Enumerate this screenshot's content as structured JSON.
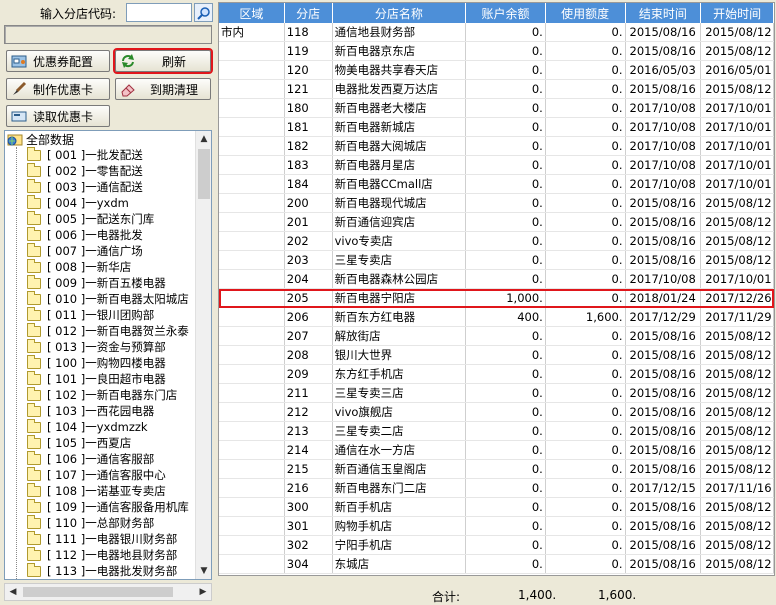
{
  "search": {
    "label": "输入分店代码:",
    "value": ""
  },
  "buttons": {
    "coupon_config": "优惠券配置",
    "refresh": "刷新",
    "make_card": "制作优惠卡",
    "expire_clean": "到期清理",
    "read_card": "读取优惠卡"
  },
  "tree": {
    "root": "全部数据",
    "items": [
      "[ 001 ]一批发配送",
      "[ 002 ]一零售配送",
      "[ 003 ]一通信配送",
      "[ 004 ]一yxdm",
      "[ 005 ]一配送东门库",
      "[ 006 ]一电器批发",
      "[ 007 ]一通信广场",
      "[ 008 ]一新华店",
      "[ 009 ]一新百五楼电器",
      "[ 010 ]一新百电器太阳城店",
      "[ 011 ]一银川团购部",
      "[ 012 ]一新百电器贺兰永泰",
      "[ 013 ]一资金与预算部",
      "[ 100 ]一购物四楼电器",
      "[ 101 ]一良田超市电器",
      "[ 102 ]一新百电器东门店",
      "[ 103 ]一西花园电器",
      "[ 104 ]一yxdmzzk",
      "[ 105 ]一西夏店",
      "[ 106 ]一通信客服部",
      "[ 107 ]一通信客服中心",
      "[ 108 ]一诺基亚专卖店",
      "[ 109 ]一通信客服备用机库",
      "[ 110 ]一总部财务部",
      "[ 111 ]一电器银川财务部",
      "[ 112 ]一电器地县财务部",
      "[ 113 ]一电器批发财务部"
    ]
  },
  "grid": {
    "headers": [
      "区域",
      "分店",
      "分店名称",
      "账户余额",
      "使用额度",
      "结束时间",
      "开始时间"
    ],
    "rows": [
      [
        "市内",
        "118",
        "通信地县财务部",
        "0.",
        "0.",
        "2015/08/16",
        "2015/08/12"
      ],
      [
        "",
        "119",
        "新百电器京东店",
        "0.",
        "0.",
        "2015/08/16",
        "2015/08/12"
      ],
      [
        "",
        "120",
        "物美电器共享春天店",
        "0.",
        "0.",
        "2016/05/03",
        "2016/05/01"
      ],
      [
        "",
        "121",
        "电器批发西夏万达店",
        "0.",
        "0.",
        "2015/08/16",
        "2015/08/12"
      ],
      [
        "",
        "180",
        "新百电器老大楼店",
        "0.",
        "0.",
        "2017/10/08",
        "2017/10/01"
      ],
      [
        "",
        "181",
        "新百电器新城店",
        "0.",
        "0.",
        "2017/10/08",
        "2017/10/01"
      ],
      [
        "",
        "182",
        "新百电器大阅城店",
        "0.",
        "0.",
        "2017/10/08",
        "2017/10/01"
      ],
      [
        "",
        "183",
        "新百电器月星店",
        "0.",
        "0.",
        "2017/10/08",
        "2017/10/01"
      ],
      [
        "",
        "184",
        "新百电器CCmall店",
        "0.",
        "0.",
        "2017/10/08",
        "2017/10/01"
      ],
      [
        "",
        "200",
        "新百电器现代城店",
        "0.",
        "0.",
        "2015/08/16",
        "2015/08/12"
      ],
      [
        "",
        "201",
        "新百通信迎宾店",
        "0.",
        "0.",
        "2015/08/16",
        "2015/08/12"
      ],
      [
        "",
        "202",
        "vivo专卖店",
        "0.",
        "0.",
        "2015/08/16",
        "2015/08/12"
      ],
      [
        "",
        "203",
        "三星专卖店",
        "0.",
        "0.",
        "2015/08/16",
        "2015/08/12"
      ],
      [
        "",
        "204",
        "新百电器森林公园店",
        "0.",
        "0.",
        "2017/10/08",
        "2017/10/01"
      ],
      [
        "",
        "205",
        "新百电器宁阳店",
        "1,000.",
        "0.",
        "2018/01/24",
        "2017/12/26"
      ],
      [
        "",
        "206",
        "新百东方红电器",
        "400.",
        "1,600.",
        "2017/12/29",
        "2017/11/29"
      ],
      [
        "",
        "207",
        "解放街店",
        "0.",
        "0.",
        "2015/08/16",
        "2015/08/12"
      ],
      [
        "",
        "208",
        "银川大世界",
        "0.",
        "0.",
        "2015/08/16",
        "2015/08/12"
      ],
      [
        "",
        "209",
        "东方红手机店",
        "0.",
        "0.",
        "2015/08/16",
        "2015/08/12"
      ],
      [
        "",
        "211",
        "三星专卖三店",
        "0.",
        "0.",
        "2015/08/16",
        "2015/08/12"
      ],
      [
        "",
        "212",
        "vivo旗舰店",
        "0.",
        "0.",
        "2015/08/16",
        "2015/08/12"
      ],
      [
        "",
        "213",
        "三星专卖二店",
        "0.",
        "0.",
        "2015/08/16",
        "2015/08/12"
      ],
      [
        "",
        "214",
        "通信在水一方店",
        "0.",
        "0.",
        "2015/08/16",
        "2015/08/12"
      ],
      [
        "",
        "215",
        "新百通信玉皇阁店",
        "0.",
        "0.",
        "2015/08/16",
        "2015/08/12"
      ],
      [
        "",
        "216",
        "新百电器东门二店",
        "0.",
        "0.",
        "2017/12/15",
        "2017/11/16"
      ],
      [
        "",
        "300",
        "新百手机店",
        "0.",
        "0.",
        "2015/08/16",
        "2015/08/12"
      ],
      [
        "",
        "301",
        "购物手机店",
        "0.",
        "0.",
        "2015/08/16",
        "2015/08/12"
      ],
      [
        "",
        "302",
        "宁阳手机店",
        "0.",
        "0.",
        "2015/08/16",
        "2015/08/12"
      ],
      [
        "",
        "304",
        "东城店",
        "0.",
        "0.",
        "2015/08/16",
        "2015/08/12"
      ]
    ],
    "highlighted_row": 14
  },
  "totals": {
    "label": "合计:",
    "balance": "1,400.",
    "used": "1,600."
  }
}
